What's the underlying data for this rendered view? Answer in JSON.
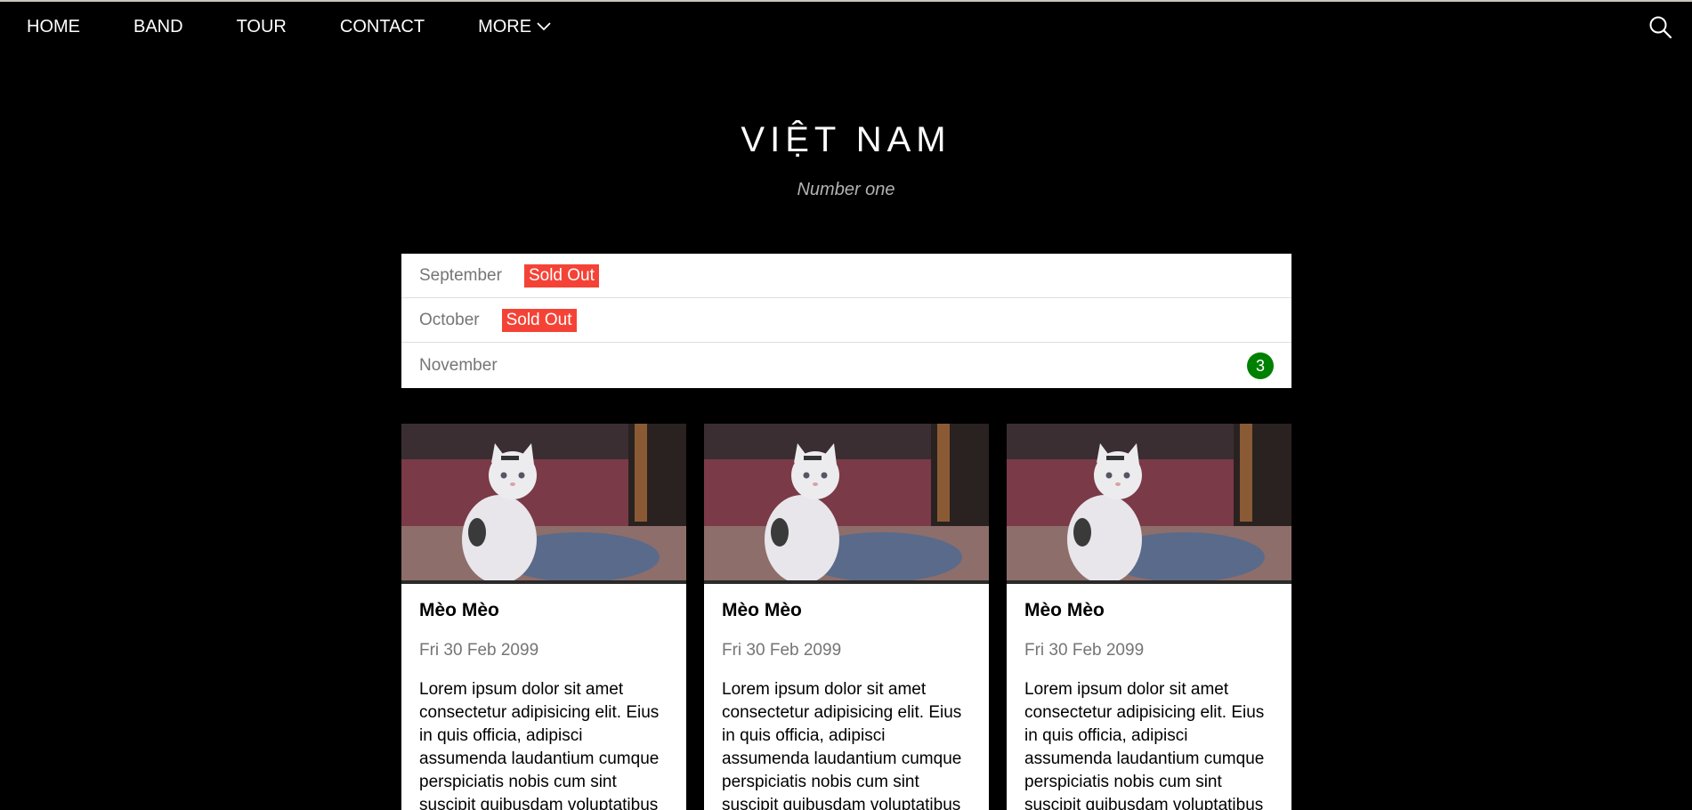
{
  "nav": {
    "items": [
      {
        "label": "HOME"
      },
      {
        "label": "BAND"
      },
      {
        "label": "TOUR"
      },
      {
        "label": "CONTACT"
      },
      {
        "label": "MORE"
      }
    ],
    "more_icon": "chevron-down-icon",
    "search_icon": "search-icon"
  },
  "hero": {
    "title": "VIỆT NAM",
    "subtitle": "Number one"
  },
  "tickets": {
    "rows": [
      {
        "month": "September",
        "badge": "Sold Out"
      },
      {
        "month": "October",
        "badge": "Sold Out"
      },
      {
        "month": "November",
        "count": "3"
      }
    ]
  },
  "cards": [
    {
      "title": "Mèo Mèo",
      "date": "Fri 30 Feb 2099",
      "text": "Lorem ipsum dolor sit amet consectetur adipisicing elit. Eius in quis officia, adipisci assumenda laudantium cumque perspiciatis nobis cum sint suscipit quibusdam voluptatibus"
    },
    {
      "title": "Mèo Mèo",
      "date": "Fri 30 Feb 2099",
      "text": "Lorem ipsum dolor sit amet consectetur adipisicing elit. Eius in quis officia, adipisci assumenda laudantium cumque perspiciatis nobis cum sint suscipit quibusdam voluptatibus"
    },
    {
      "title": "Mèo Mèo",
      "date": "Fri 30 Feb 2099",
      "text": "Lorem ipsum dolor sit amet consectetur adipisicing elit. Eius in quis officia, adipisci assumenda laudantium cumque perspiciatis nobis cum sint suscipit quibusdam voluptatibus"
    }
  ],
  "colors": {
    "background": "#000000",
    "sold_out": "#f44336",
    "count_badge": "#008000"
  }
}
